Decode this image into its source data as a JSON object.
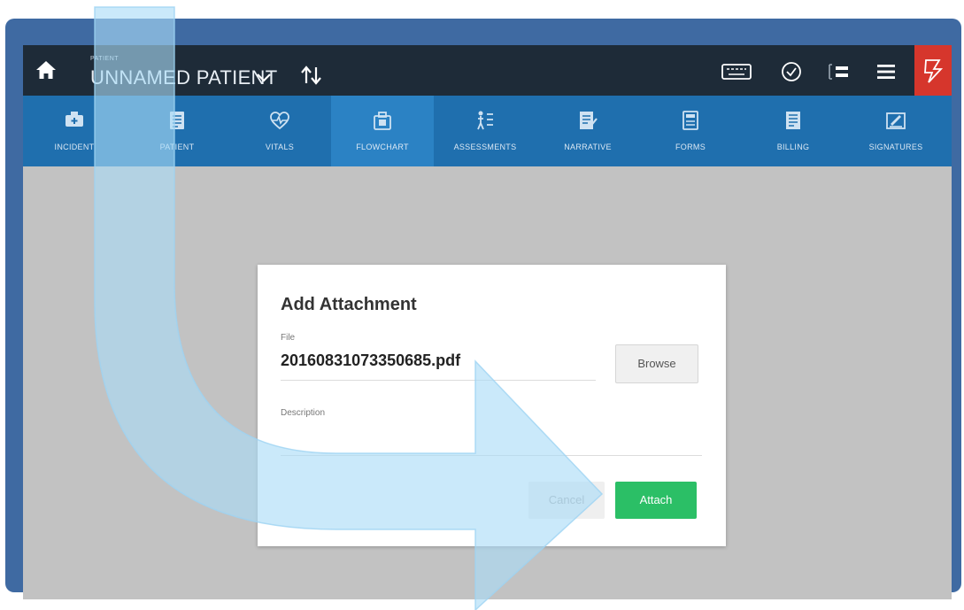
{
  "topbar": {
    "patient_small_label": "PATIENT",
    "patient_name": "UNNAMED PATIENT",
    "icons": [
      "home-icon",
      "chevron-down-icon",
      "sort-arrows-icon",
      "keyboard-icon",
      "check-circle-icon",
      "list-icon",
      "menu-icon",
      "alert-icon"
    ]
  },
  "nav": {
    "items": [
      {
        "label": "INCIDENT",
        "icon": "ambulance-icon"
      },
      {
        "label": "PATIENT",
        "icon": "patient-icon"
      },
      {
        "label": "VITALS",
        "icon": "heart-pulse-icon"
      },
      {
        "label": "FLOWCHART",
        "icon": "medical-bag-icon",
        "active": true
      },
      {
        "label": "ASSESSMENTS",
        "icon": "assessment-icon"
      },
      {
        "label": "NARRATIVE",
        "icon": "narrative-icon"
      },
      {
        "label": "FORMS",
        "icon": "forms-icon"
      },
      {
        "label": "BILLING",
        "icon": "billing-icon"
      },
      {
        "label": "SIGNATURES",
        "icon": "signature-icon"
      }
    ]
  },
  "dialog": {
    "title": "Add Attachment",
    "file_label": "File",
    "file_value": "20160831073350685.pdf",
    "browse_label": "Browse",
    "description_label": "Description",
    "cancel_label": "Cancel",
    "attach_label": "Attach"
  },
  "colors": {
    "frame": "#3f6aa2",
    "topbar": "#1e2b38",
    "navbar": "#1f6fae",
    "nav_active": "#2b82c4",
    "alert": "#d6362c",
    "attach": "#2bbf66",
    "overlay_arrow": "#a9dcf7"
  }
}
